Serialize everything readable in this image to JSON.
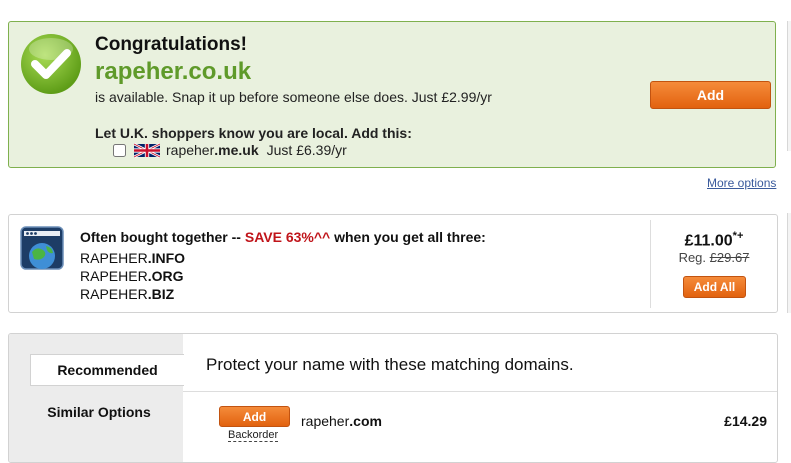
{
  "success": {
    "congrats": "Congratulations!",
    "domain": "rapeher.co.uk",
    "available_text": "is available. Snap it up before someone else does. Just £2.99/yr",
    "add_label": "Add",
    "local_heading": "Let U.K. shoppers know you are local. Add this:",
    "local_option": {
      "name_base": "rapeher",
      "name_ext": ".me.uk",
      "price": "Just £6.39/yr",
      "checked": false,
      "flag_icon": "uk-flag-icon"
    },
    "check_icon": "checkmark-icon",
    "accent_green": "#5f9a2a"
  },
  "more_options": "More options",
  "bundle": {
    "heading_prefix": "Often bought together -- ",
    "save_label": "SAVE 63%^^",
    "heading_suffix": " when you get all three:",
    "domains": [
      {
        "base": "RAPEHER",
        "ext": ".INFO"
      },
      {
        "base": "RAPEHER",
        "ext": ".ORG"
      },
      {
        "base": "RAPEHER",
        "ext": ".BIZ"
      }
    ],
    "price": "£11.00",
    "price_mark": "*+",
    "reg_label": "Reg.",
    "reg_price": "£29.67",
    "add_all_label": "Add All",
    "icon": "globe-window-icon",
    "save_color": "#c0141a"
  },
  "recommended": {
    "tabs": {
      "recommended": "Recommended",
      "similar": "Similar Options"
    },
    "heading": "Protect your name with these matching domains.",
    "rows": [
      {
        "add_label": "Add",
        "backorder_label": "Backorder",
        "name_base": "rapeher",
        "name_ext": ".com",
        "price": "£14.29"
      }
    ]
  },
  "button_color": "#e2620f"
}
